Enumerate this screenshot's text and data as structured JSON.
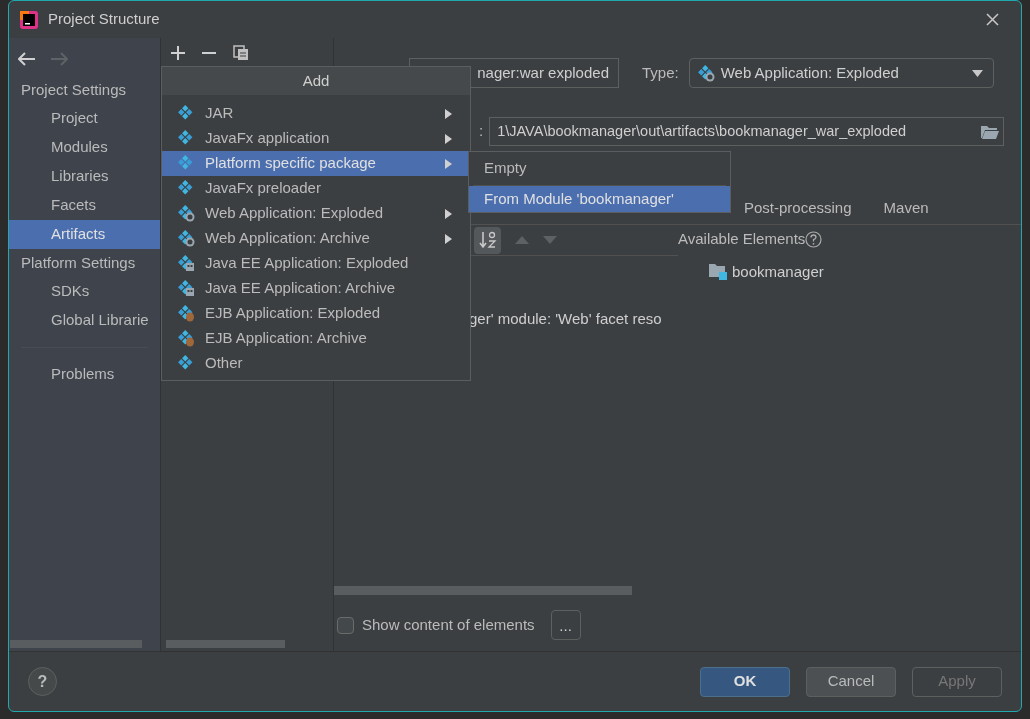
{
  "window": {
    "title": "Project Structure"
  },
  "sidebar": {
    "sections": [
      {
        "title": "Project Settings",
        "items": [
          {
            "label": "Project",
            "selected": false
          },
          {
            "label": "Modules",
            "selected": false
          },
          {
            "label": "Libraries",
            "selected": false
          },
          {
            "label": "Facets",
            "selected": false
          },
          {
            "label": "Artifacts",
            "selected": true
          }
        ]
      },
      {
        "title": "Platform Settings",
        "items": [
          {
            "label": "SDKs",
            "selected": false
          },
          {
            "label": "Global Librarie",
            "selected": false
          }
        ]
      }
    ],
    "bottom_items": [
      {
        "label": "Problems",
        "selected": false
      }
    ]
  },
  "artifact": {
    "name": "nager:war exploded",
    "type_field": {
      "label": "Type:",
      "value": "Web Application: Exploded",
      "kind": "web"
    },
    "output_label": ":",
    "output_path": "1\\JAVA\\bookmanager\\out\\artifacts\\bookmanager_war_exploded",
    "tabs": [
      {
        "label": "Post-processing",
        "selected": false
      },
      {
        "label": "Maven",
        "selected": false
      }
    ],
    "message": "ger' module: 'Web' facet reso",
    "available_title": "Available Elements",
    "available_items": [
      "bookmanager"
    ],
    "show_content": {
      "label": "Show content of elements",
      "checked": false
    },
    "more_button": "..."
  },
  "add_menu": {
    "title": "Add",
    "items": [
      {
        "label": "JAR",
        "kind": "package",
        "has_submenu": true,
        "selected": false
      },
      {
        "label": "JavaFx application",
        "kind": "package",
        "has_submenu": true,
        "selected": false
      },
      {
        "label": "Platform specific package",
        "kind": "package",
        "has_submenu": true,
        "selected": true
      },
      {
        "label": "JavaFx preloader",
        "kind": "package",
        "has_submenu": false,
        "selected": false
      },
      {
        "label": "Web Application: Exploded",
        "kind": "web",
        "has_submenu": true,
        "selected": false
      },
      {
        "label": "Web Application: Archive",
        "kind": "web",
        "has_submenu": true,
        "selected": false
      },
      {
        "label": "Java EE Application: Exploded",
        "kind": "javaee",
        "has_submenu": false,
        "selected": false
      },
      {
        "label": "Java EE Application: Archive",
        "kind": "javaee",
        "has_submenu": false,
        "selected": false
      },
      {
        "label": "EJB Application: Exploded",
        "kind": "ejb",
        "has_submenu": false,
        "selected": false
      },
      {
        "label": "EJB Application: Archive",
        "kind": "ejb",
        "has_submenu": false,
        "selected": false
      },
      {
        "label": "Other",
        "kind": "package",
        "has_submenu": false,
        "selected": false
      }
    ]
  },
  "submenu": {
    "items": [
      {
        "label": "Empty",
        "selected": false
      },
      {
        "label": "From Module 'bookmanager'",
        "selected": true
      }
    ]
  },
  "footer": {
    "help": "?",
    "buttons": [
      {
        "label": "OK",
        "kind": "primary",
        "disabled": false
      },
      {
        "label": "Cancel",
        "kind": "normal",
        "disabled": false
      },
      {
        "label": "Apply",
        "kind": "normal",
        "disabled": true
      }
    ]
  }
}
